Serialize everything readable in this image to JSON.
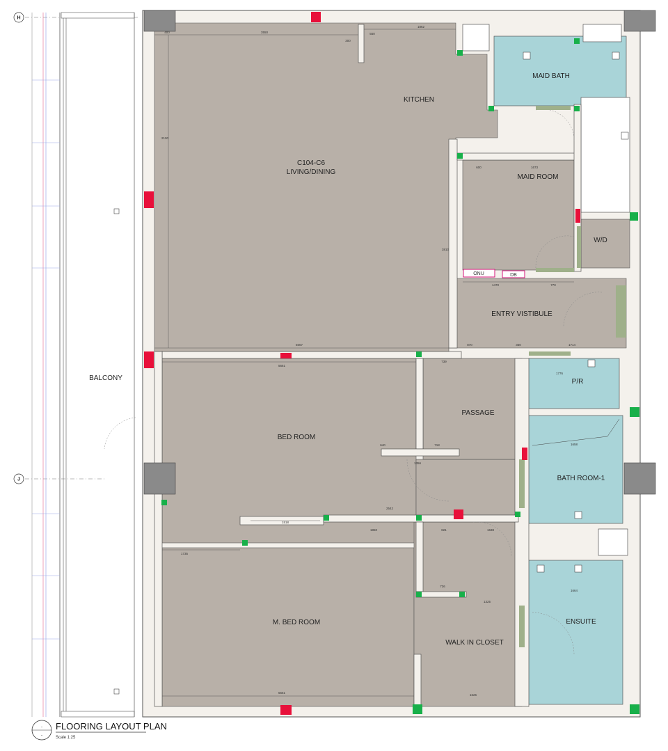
{
  "colors": {
    "floor": "#b8b0a8",
    "wet_area": "#a9d4d8",
    "wall": "#f4f1ec",
    "wall_stroke": "#555555",
    "column": "#8a8a8a",
    "red_marker": "#e8103a",
    "green_marker": "#18b04a",
    "door_strip": "#9fb08a",
    "magenta": "#d4147a",
    "grid_line": "#7c6cf0"
  },
  "grid": {
    "h": "H",
    "j": "J"
  },
  "rooms": {
    "living_code": "C104-C6",
    "living": "LIVING/DINING",
    "kitchen": "KITCHEN",
    "maid_bath": "MAID BATH",
    "maid_room": "MAID ROOM",
    "wd": "W/D",
    "entry": "ENTRY VISTIBULE",
    "balcony": "BALCONY",
    "bed_room": "BED ROOM",
    "passage": "PASSAGE",
    "pr": "P/R",
    "bath1": "BATH ROOM-1",
    "mbed": "M. BED ROOM",
    "wic": "WALK IN CLOSET",
    "ensuite": "ENSUITE"
  },
  "tags": {
    "onu": "ONU",
    "db": "DB"
  },
  "dims": {
    "d1": "400",
    "d2": "3550",
    "d3": "1862",
    "d4": "300",
    "d5": "550",
    "d6": "5667",
    "d7": "870",
    "d8": "350",
    "d9": "1714",
    "d10": "5661",
    "d11": "739",
    "d12": "1470",
    "d13": "770",
    "d14": "600",
    "d15": "1673",
    "d16": "1776",
    "d17": "1658",
    "d18": "640",
    "d19": "718",
    "d20": "1356",
    "d21": "2542",
    "d22": "1518",
    "d23": "1850",
    "d24": "821",
    "d25": "1638",
    "d26": "1735",
    "d27": "736",
    "d28": "1325",
    "d29": "5661",
    "d30": "1626",
    "d31": "1664",
    "d32": "2100",
    "d33": "3810"
  },
  "title": {
    "name": "FLOORING LAYOUT PLAN",
    "scale": "Scale 1:25",
    "marker": "-"
  }
}
